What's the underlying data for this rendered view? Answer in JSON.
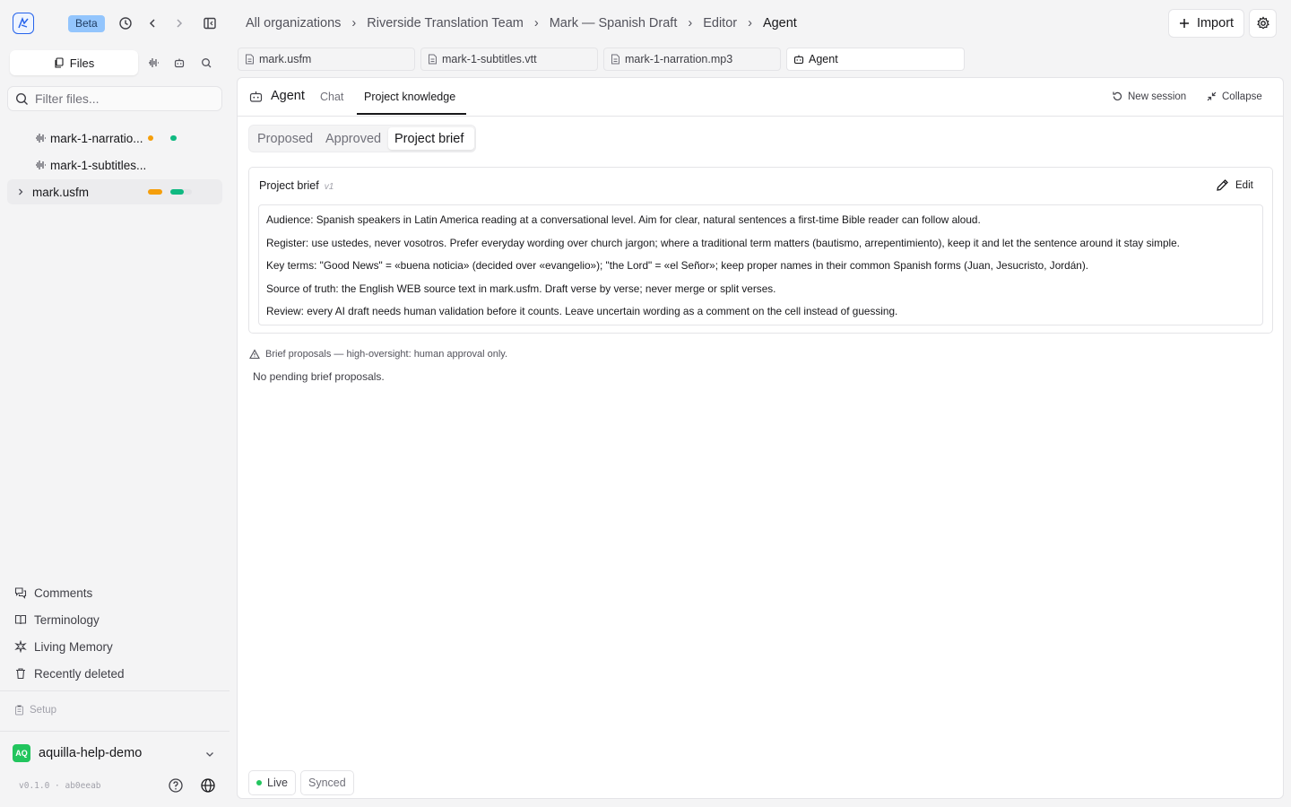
{
  "top": {
    "beta": "Beta",
    "breadcrumb": [
      "All organizations",
      "Riverside Translation Team",
      "Mark — Spanish Draft",
      "Editor",
      "Agent"
    ],
    "separator": "›",
    "import_label": "Import"
  },
  "sidebar": {
    "files_tab": "Files",
    "filter_placeholder": "Filter files...",
    "files": [
      {
        "name": "mark-1-narratio...",
        "icon": "audio-waveform-icon"
      },
      {
        "name": "mark-1-subtitles...",
        "icon": "audio-waveform-icon"
      },
      {
        "name": "mark.usfm",
        "icon": "chevron-right-icon"
      }
    ],
    "nav": [
      "Comments",
      "Terminology",
      "Living Memory",
      "Recently deleted"
    ],
    "setup": "Setup",
    "org_initials": "AQ",
    "org_name": "aquilla-help-demo",
    "version": "v0.1.0 · ab0eeab"
  },
  "tabs": [
    {
      "label": "mark.usfm"
    },
    {
      "label": "mark-1-subtitles.vtt"
    },
    {
      "label": "mark-1-narration.mp3"
    },
    {
      "label": "Agent"
    }
  ],
  "agent": {
    "title": "Agent",
    "tab_chat": "Chat",
    "tab_knowledge": "Project knowledge",
    "new_session": "New session",
    "collapse": "Collapse",
    "segments": [
      "Proposed",
      "Approved",
      "Project brief"
    ],
    "brief_title": "Project brief",
    "brief_version": "v1",
    "edit": "Edit",
    "brief_lines": [
      "Audience: Spanish speakers in Latin America reading at a conversational level. Aim for clear, natural sentences a first-time Bible reader can follow aloud.",
      "Register: use ustedes, never vosotros. Prefer everyday wording over church jargon; where a traditional term matters (bautismo, arrepentimiento), keep it and let the sentence around it stay simple.",
      "Key terms: \"Good News\" = «buena noticia» (decided over «evangelio»); \"the Lord\" = «el Señor»; keep proper names in their common Spanish forms (Juan, Jesucristo, Jordán).",
      "Source of truth: the English WEB source text in mark.usfm. Draft verse by verse; never merge or split verses.",
      "Review: every AI draft needs human validation before it counts. Leave uncertain wording as a comment on the cell instead of guessing."
    ],
    "warning": "Brief proposals — high-oversight: human approval only.",
    "empty": "No pending brief proposals.",
    "status_live": "Live",
    "status_synced": "Synced"
  },
  "colors": {
    "accent": "#2563eb",
    "live": "#22c55e",
    "orange": "#f59e0b",
    "green": "#10b981"
  }
}
